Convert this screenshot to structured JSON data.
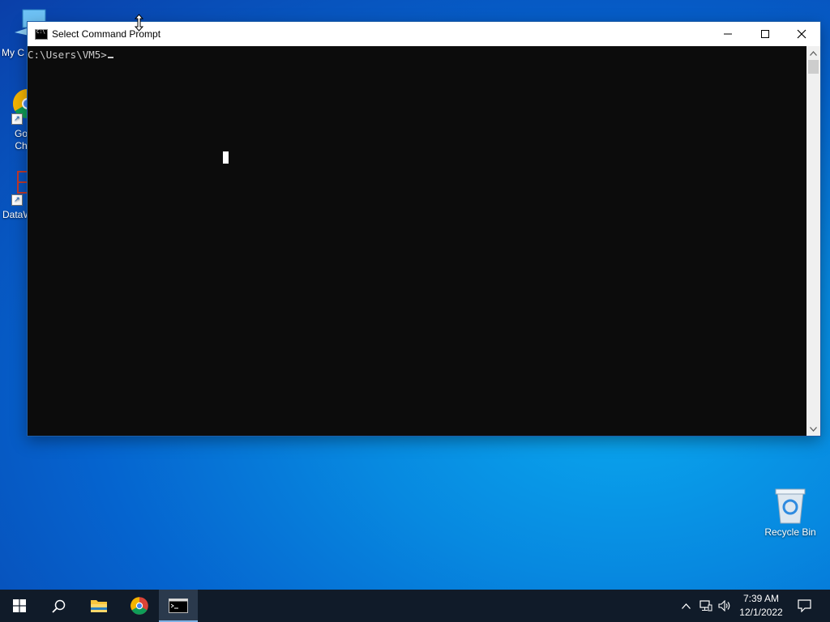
{
  "desktop": {
    "icons": [
      {
        "label": "My C",
        "icon": "computer-icon"
      },
      {
        "label": "Go\nCh",
        "icon": "chrome-icon"
      },
      {
        "label": "DataW",
        "icon": "datawrapper-icon"
      },
      {
        "label": "Recycle Bin",
        "icon": "recycle-bin-icon"
      }
    ]
  },
  "window": {
    "title": "Select Command Prompt",
    "console_line": "C:\\Users\\VM5>",
    "controls": {
      "minimize": "minimize-icon",
      "maximize": "maximize-icon",
      "close": "close-icon"
    }
  },
  "taskbar": {
    "buttons": [
      "start-icon",
      "search-icon",
      "file-explorer-icon",
      "chrome-icon",
      "command-prompt-icon"
    ],
    "tray": [
      "chevron-up-icon",
      "network-icon",
      "volume-icon",
      "notification-icon"
    ],
    "time": "7:39 AM",
    "date": "12/1/2022"
  },
  "colors": {
    "console_bg": "#0c0c0c",
    "taskbar_bg": "#101b29",
    "desktop_accent": "#0789e0"
  }
}
